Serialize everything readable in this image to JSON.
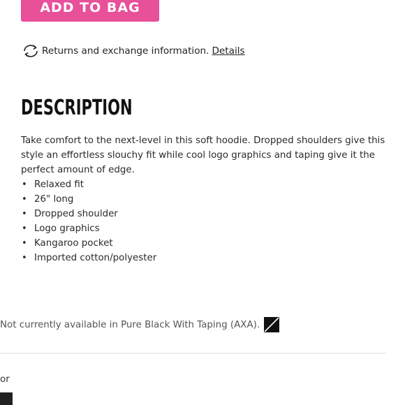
{
  "product": {
    "add_to_bag_label": "ADD TO BAG"
  },
  "returns": {
    "icon": "exchange-arrows-icon",
    "text": "Returns and exchange information.",
    "link_label": "Details"
  },
  "description": {
    "heading": "DESCRIPTION",
    "paragraph": "Take comfort to the next-level in this soft hoodie. Dropped shoulders give this style an effortless slouchy fit while cool logo graphics and taping give it the perfect amount of edge.",
    "bullets": [
      "Relaxed fit",
      "26\" long",
      "Dropped shoulder",
      "Logo graphics",
      "Kangaroo pocket",
      "Imported cotton/polyester"
    ]
  },
  "availability": {
    "text": "Not currently available in Pure Black With Taping (AXA).",
    "swatch_icon": "unavailable-swatch-icon"
  },
  "next_section": {
    "partial_label": "or"
  },
  "colors": {
    "accent": "#e8509a",
    "text": "#222222",
    "muted": "#555555",
    "divider": "#eeeeee"
  }
}
